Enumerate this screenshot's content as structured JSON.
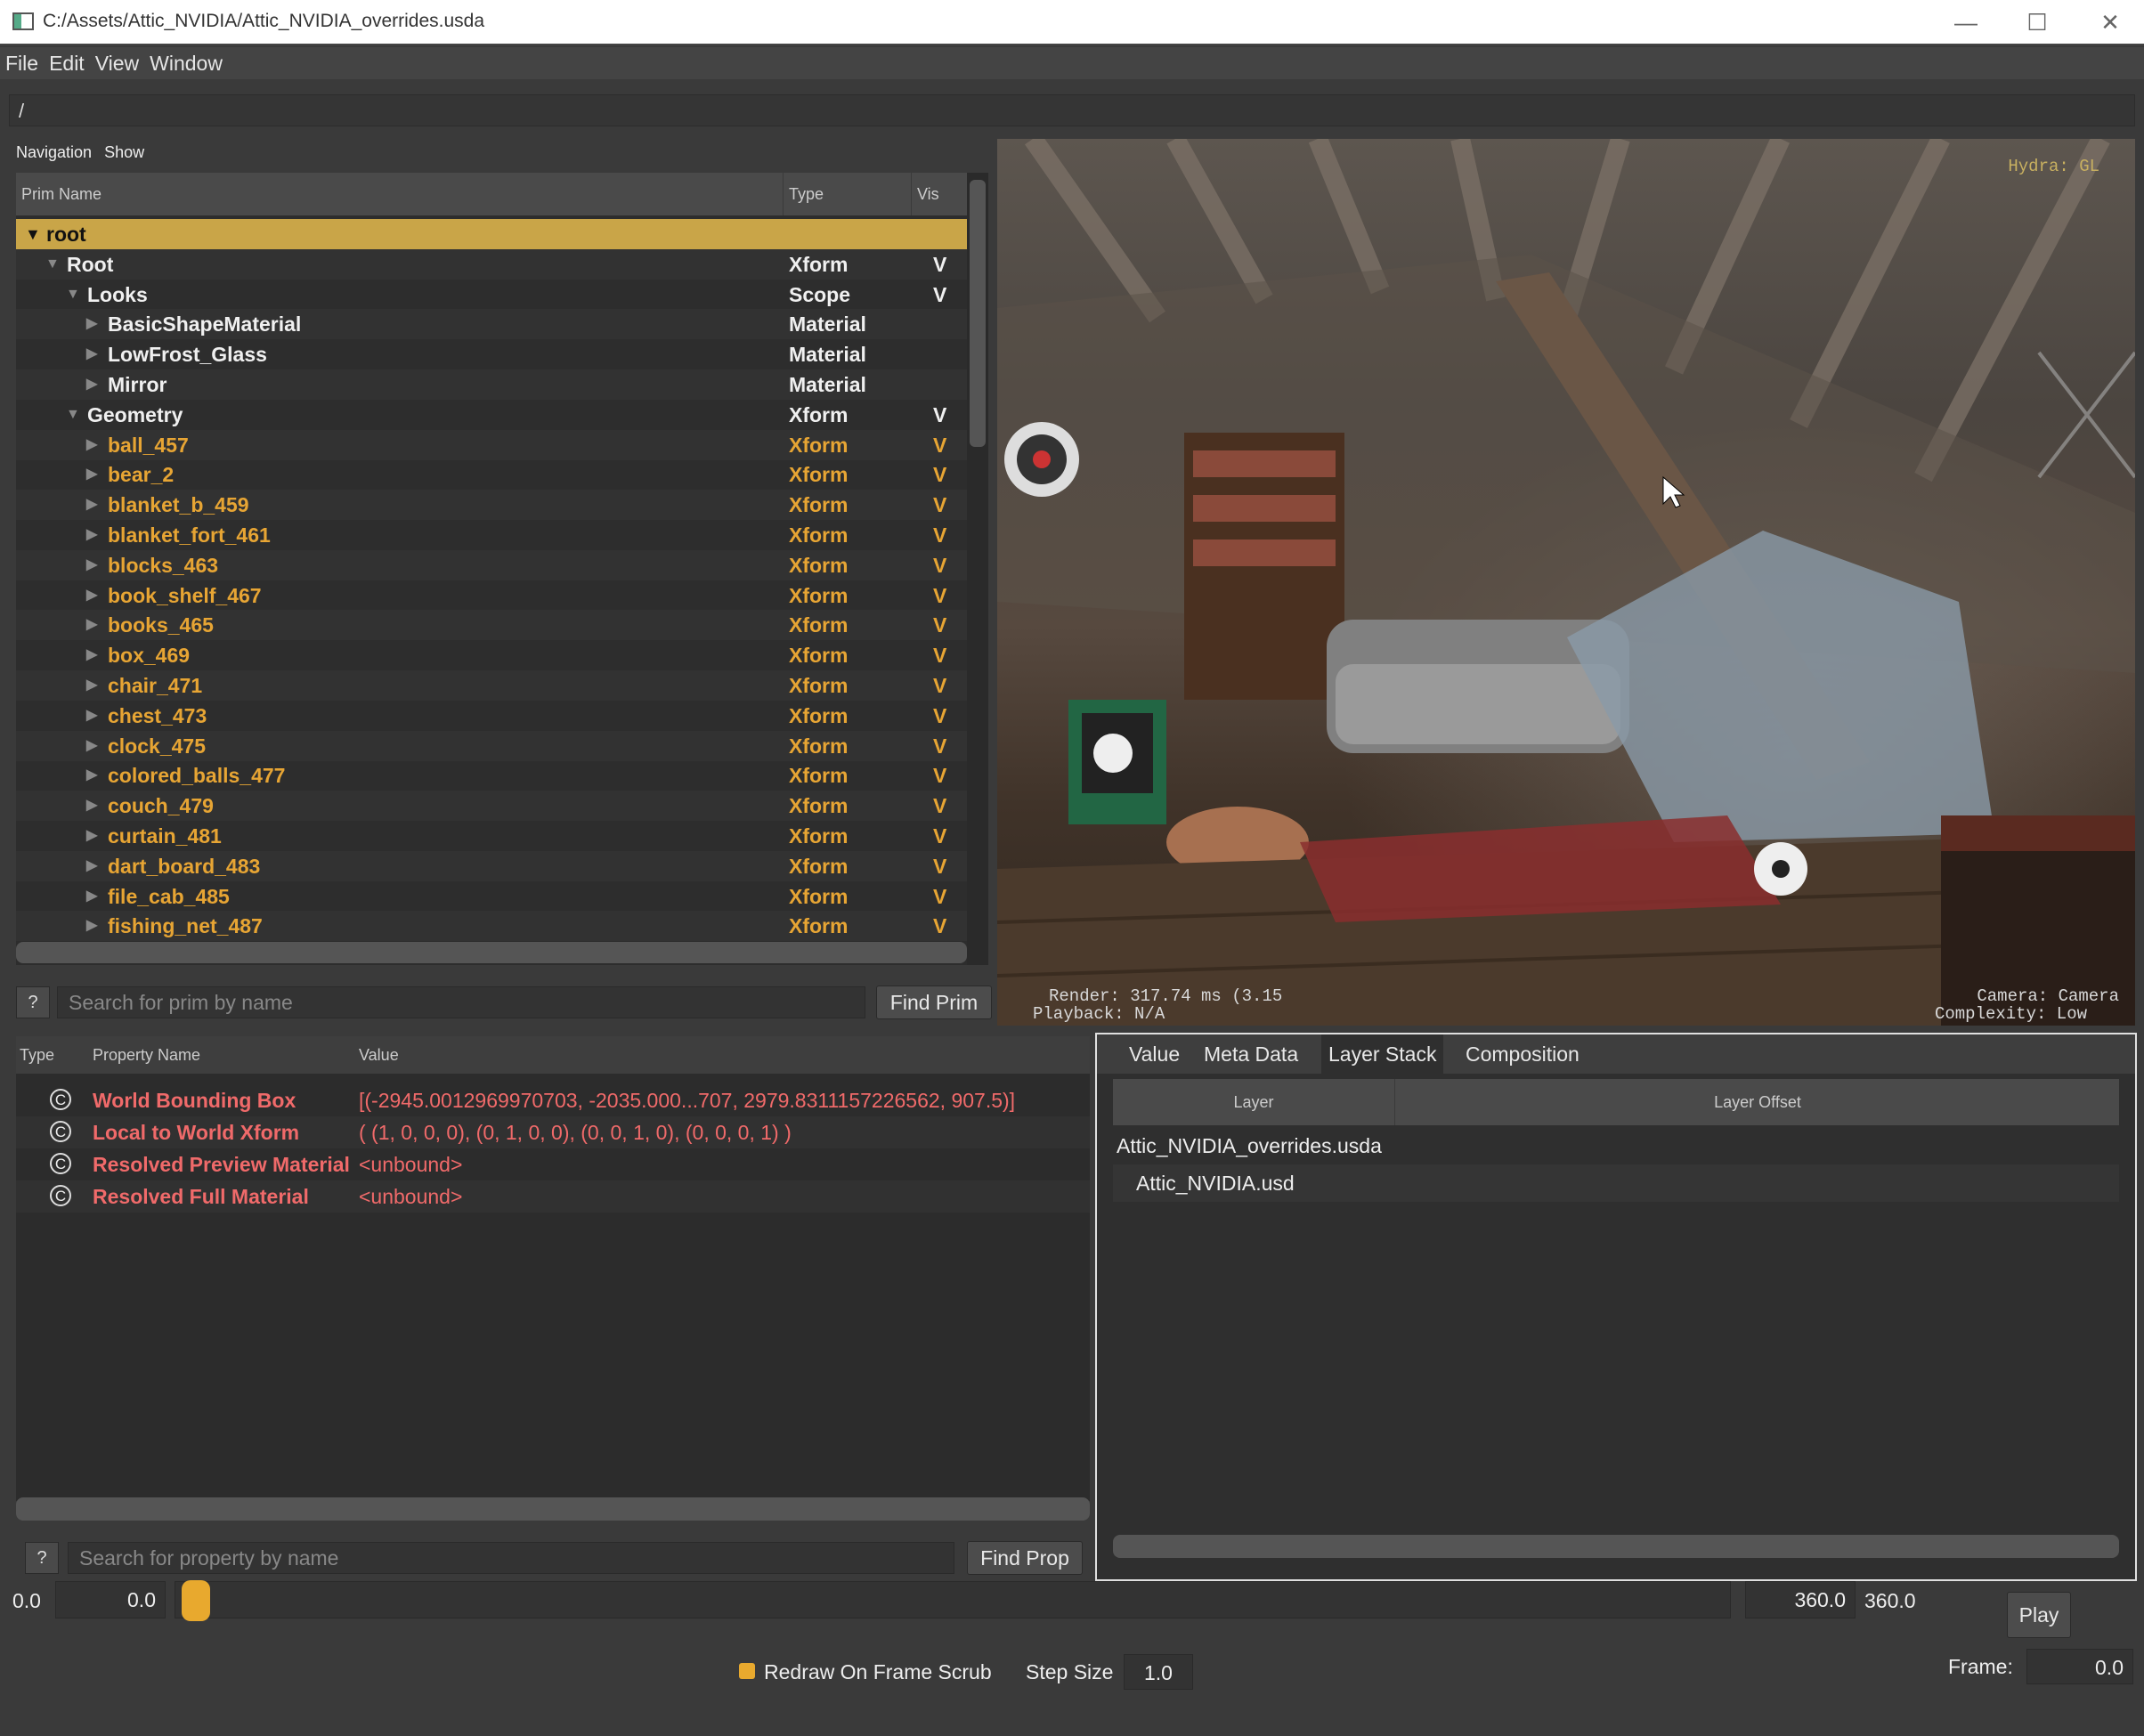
{
  "window": {
    "title": "C:/Assets/Attic_NVIDIA/Attic_NVIDIA_overrides.usda",
    "minimize": "—",
    "maximize": "☐",
    "close": "✕"
  },
  "menu": [
    "File",
    "Edit",
    "View",
    "Window"
  ],
  "path": "/",
  "nav": {
    "navigation": "Navigation",
    "show": "Show"
  },
  "prim_tree": {
    "headers": {
      "name": "Prim Name",
      "type": "Type",
      "vis": "Vis"
    },
    "rows": [
      {
        "name": "root",
        "type": "",
        "vis": "",
        "depth": 0,
        "expanded": true,
        "selected": true,
        "color": "dark"
      },
      {
        "name": "Root",
        "type": "Xform",
        "vis": "V",
        "depth": 1,
        "expanded": true,
        "color": "white"
      },
      {
        "name": "Looks",
        "type": "Scope",
        "vis": "V",
        "depth": 2,
        "expanded": true,
        "color": "white"
      },
      {
        "name": "BasicShapeMaterial",
        "type": "Material",
        "vis": "",
        "depth": 3,
        "expanded": false,
        "color": "white"
      },
      {
        "name": "LowFrost_Glass",
        "type": "Material",
        "vis": "",
        "depth": 3,
        "expanded": false,
        "color": "white"
      },
      {
        "name": "Mirror",
        "type": "Material",
        "vis": "",
        "depth": 3,
        "expanded": false,
        "color": "white"
      },
      {
        "name": "Geometry",
        "type": "Xform",
        "vis": "V",
        "depth": 2,
        "expanded": true,
        "color": "white"
      },
      {
        "name": "ball_457",
        "type": "Xform",
        "vis": "V",
        "depth": 3,
        "expanded": false,
        "color": "orange"
      },
      {
        "name": "bear_2",
        "type": "Xform",
        "vis": "V",
        "depth": 3,
        "expanded": false,
        "color": "orange"
      },
      {
        "name": "blanket_b_459",
        "type": "Xform",
        "vis": "V",
        "depth": 3,
        "expanded": false,
        "color": "orange"
      },
      {
        "name": "blanket_fort_461",
        "type": "Xform",
        "vis": "V",
        "depth": 3,
        "expanded": false,
        "color": "orange"
      },
      {
        "name": "blocks_463",
        "type": "Xform",
        "vis": "V",
        "depth": 3,
        "expanded": false,
        "color": "orange"
      },
      {
        "name": "book_shelf_467",
        "type": "Xform",
        "vis": "V",
        "depth": 3,
        "expanded": false,
        "color": "orange"
      },
      {
        "name": "books_465",
        "type": "Xform",
        "vis": "V",
        "depth": 3,
        "expanded": false,
        "color": "orange"
      },
      {
        "name": "box_469",
        "type": "Xform",
        "vis": "V",
        "depth": 3,
        "expanded": false,
        "color": "orange"
      },
      {
        "name": "chair_471",
        "type": "Xform",
        "vis": "V",
        "depth": 3,
        "expanded": false,
        "color": "orange"
      },
      {
        "name": "chest_473",
        "type": "Xform",
        "vis": "V",
        "depth": 3,
        "expanded": false,
        "color": "orange"
      },
      {
        "name": "clock_475",
        "type": "Xform",
        "vis": "V",
        "depth": 3,
        "expanded": false,
        "color": "orange"
      },
      {
        "name": "colored_balls_477",
        "type": "Xform",
        "vis": "V",
        "depth": 3,
        "expanded": false,
        "color": "orange"
      },
      {
        "name": "couch_479",
        "type": "Xform",
        "vis": "V",
        "depth": 3,
        "expanded": false,
        "color": "orange"
      },
      {
        "name": "curtain_481",
        "type": "Xform",
        "vis": "V",
        "depth": 3,
        "expanded": false,
        "color": "orange"
      },
      {
        "name": "dart_board_483",
        "type": "Xform",
        "vis": "V",
        "depth": 3,
        "expanded": false,
        "color": "orange"
      },
      {
        "name": "file_cab_485",
        "type": "Xform",
        "vis": "V",
        "depth": 3,
        "expanded": false,
        "color": "orange"
      },
      {
        "name": "fishing_net_487",
        "type": "Xform",
        "vis": "V",
        "depth": 3,
        "expanded": false,
        "color": "orange"
      }
    ]
  },
  "prim_search": {
    "help": "?",
    "placeholder": "Search for prim by name",
    "button": "Find Prim"
  },
  "viewport": {
    "renderer": "Hydra: GL",
    "render_stats": "Render: 317.74 ms (3.15",
    "playback": "Playback: N/A",
    "camera": "Camera: Camera",
    "complexity": "Complexity: Low"
  },
  "properties": {
    "headers": {
      "type": "Type",
      "name": "Property Name",
      "value": "Value"
    },
    "rows": [
      {
        "icon": "C",
        "name": "World Bounding Box",
        "value": "[(-2945.0012969970703, -2035.000...707, 2979.8311157226562, 907.5)]"
      },
      {
        "icon": "C",
        "name": "Local to World Xform",
        "value": "( (1, 0, 0, 0), (0, 1, 0, 0), (0, 0, 1, 0), (0, 0, 0, 1) )"
      },
      {
        "icon": "C",
        "name": "Resolved Preview Material",
        "value": "<unbound>"
      },
      {
        "icon": "C",
        "name": "Resolved Full Material",
        "value": "<unbound>"
      }
    ]
  },
  "prop_search": {
    "help": "?",
    "placeholder": "Search for property by name",
    "button": "Find Prop"
  },
  "right_panel": {
    "tabs": [
      "Value",
      "Meta Data",
      "Layer Stack",
      "Composition"
    ],
    "active_tab": "Layer Stack",
    "headers": {
      "layer": "Layer",
      "offset": "Layer Offset"
    },
    "layers": [
      {
        "name": "Attic_NVIDIA_overrides.usda",
        "offset": ""
      },
      {
        "name": "Attic_NVIDIA.usd",
        "offset": ""
      }
    ]
  },
  "timeline": {
    "start": "0.0",
    "start_field": "0.0",
    "end_field": "360.0",
    "end": "360.0",
    "play": "Play",
    "redraw_label": "Redraw On Frame Scrub",
    "redraw_checked": true,
    "step_label": "Step Size",
    "step_value": "1.0",
    "frame_label": "Frame:",
    "frame_value": "0.0",
    "slider_fraction": 0.0
  },
  "colors": {
    "accent": "#e7a534",
    "selection": "#c9a548",
    "property": "#f06a6a"
  }
}
